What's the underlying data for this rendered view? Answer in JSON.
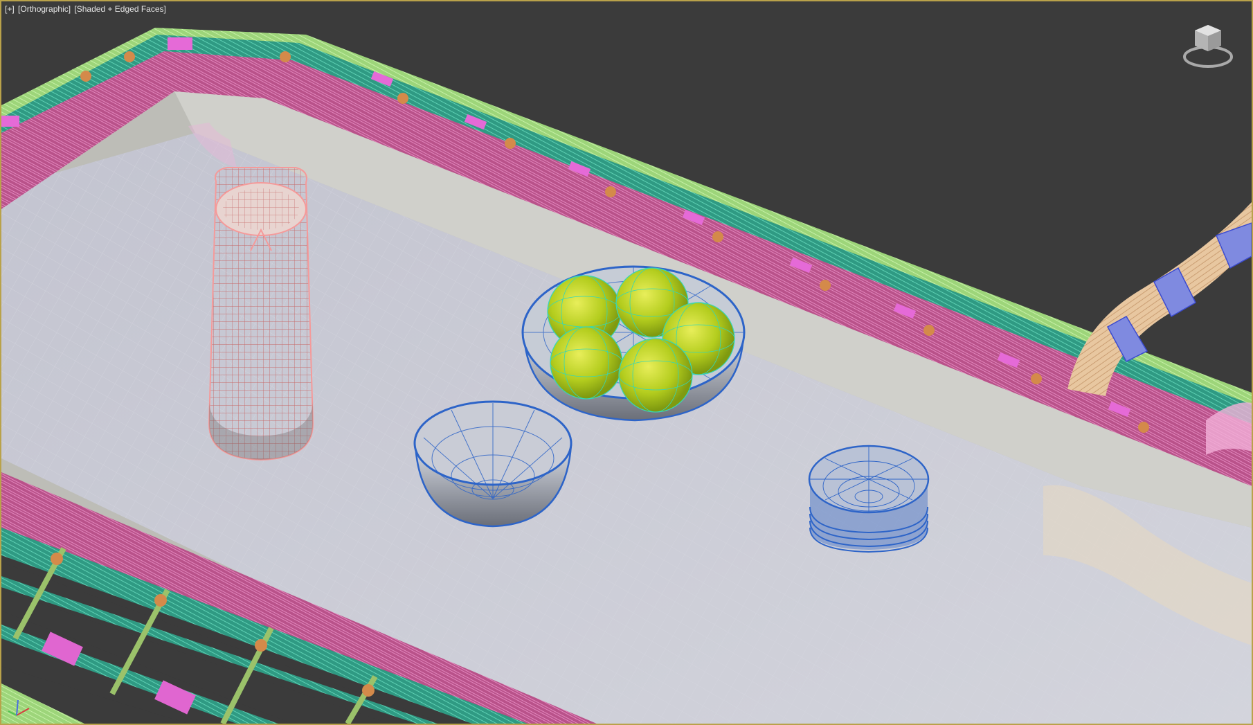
{
  "viewport": {
    "label": {
      "plus_menu": "[+]",
      "view_menu": "[Orthographic]",
      "shading_menu": "[Shaded + Edged Faces]"
    },
    "active_border_color": "#b9a24a",
    "background_color": "#3b3b3b"
  },
  "scene_colors": {
    "tray_surface": "#c9cad5",
    "tray_wall": "#c4c4be",
    "rim_pink": "#c0508f",
    "rim_teal": "#3aa88c",
    "rim_lime": "#a6d87a",
    "vase": "#f59a9a",
    "bowl_wire": "#2d64c8",
    "apple": "#a6c21e",
    "apple_wire": "#34d7b8",
    "handle": "#e8c7a0",
    "handle_ring": "#7f8ae0"
  },
  "icons": {
    "viewcube": "viewcube-icon",
    "axis": "axis-tripod-icon"
  }
}
